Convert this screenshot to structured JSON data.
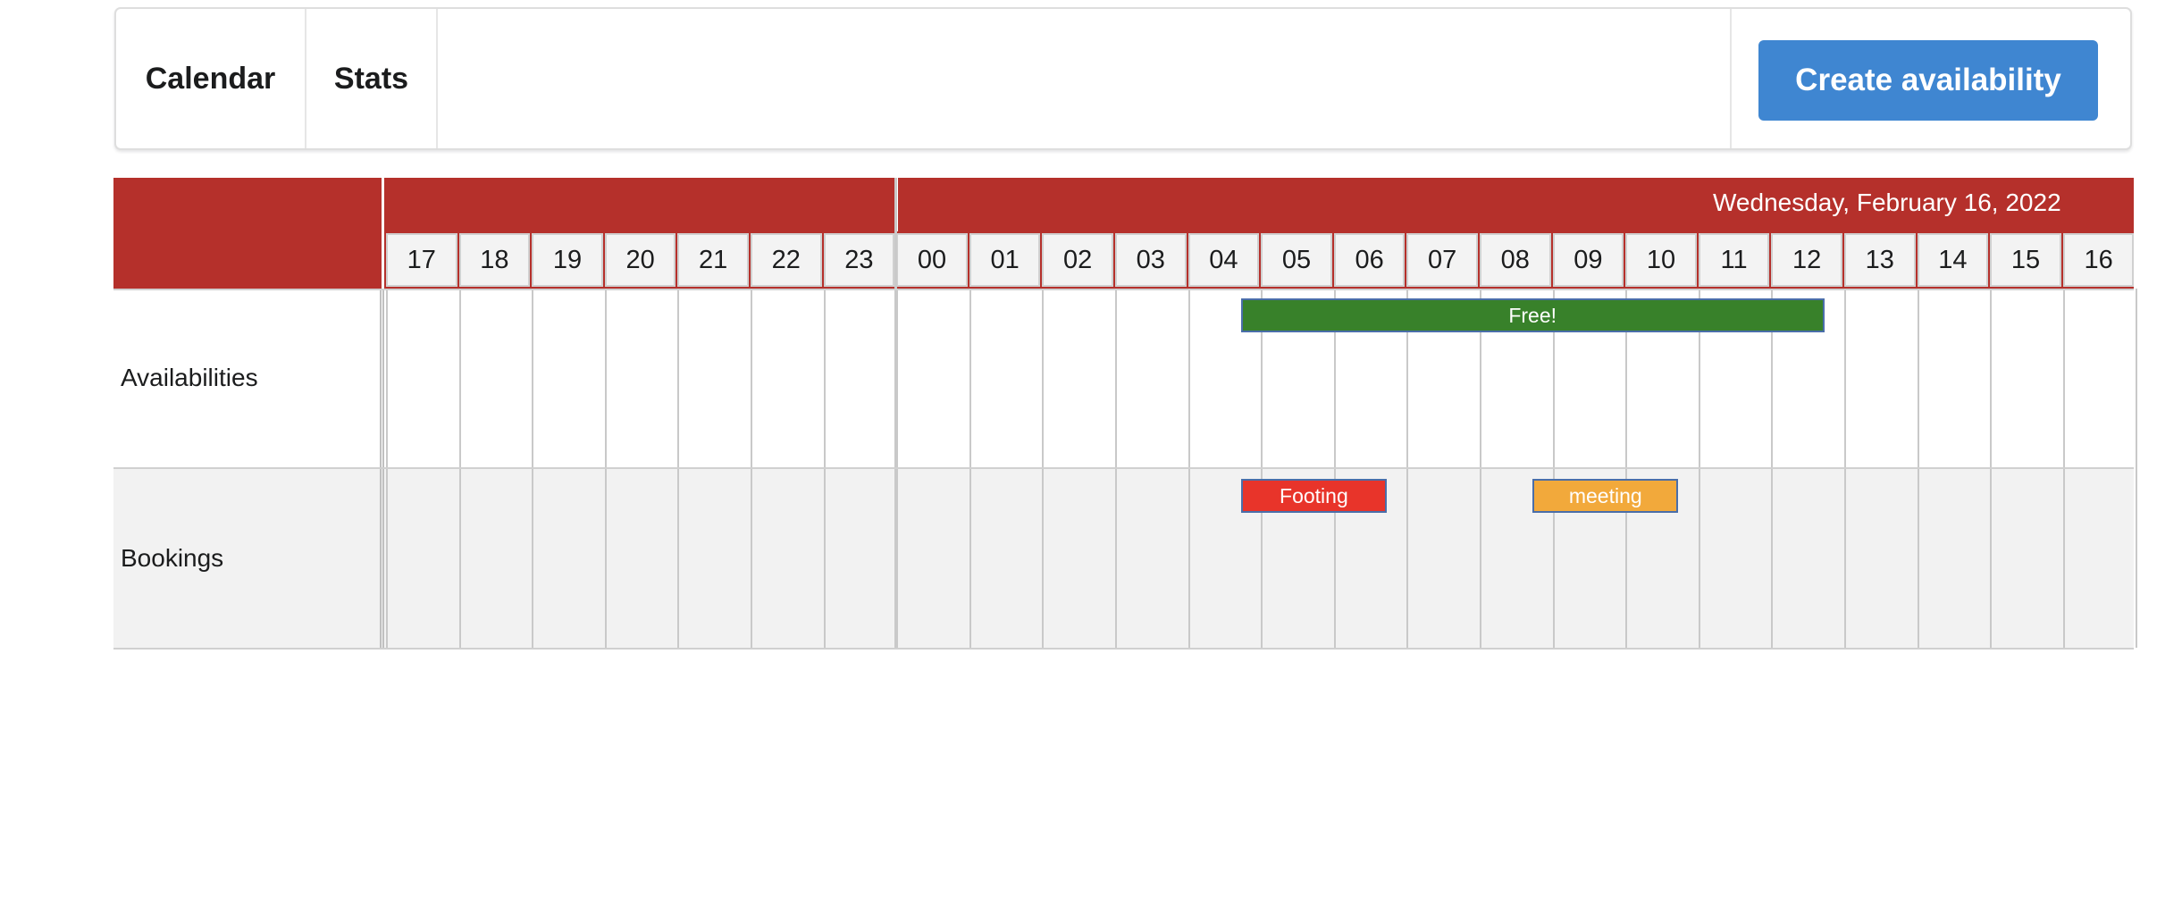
{
  "menu": {
    "calendar_label": "Calendar",
    "stats_label": "Stats",
    "create_button_label": "Create availability"
  },
  "timeline": {
    "day_label": "Wednesday, February 16, 2022",
    "hours": [
      "17",
      "18",
      "19",
      "20",
      "21",
      "22",
      "23",
      "00",
      "01",
      "02",
      "03",
      "04",
      "05",
      "06",
      "07",
      "08",
      "09",
      "10",
      "11",
      "12",
      "13",
      "14",
      "15",
      "16"
    ],
    "rows": [
      {
        "label": "Availabilities"
      },
      {
        "label": "Bookings"
      }
    ],
    "events": [
      {
        "row": 0,
        "title": "Free!",
        "start_hour": 4.75,
        "end_hour": 12.75,
        "color": "#38812a"
      },
      {
        "row": 1,
        "title": "Footing",
        "start_hour": 4.75,
        "end_hour": 6.75,
        "color": "#e8342a"
      },
      {
        "row": 1,
        "title": "meeting",
        "start_hour": 8.75,
        "end_hour": 10.75,
        "color": "#f2a93b"
      }
    ]
  },
  "colors": {
    "header_red": "#b5302b",
    "primary_blue": "#3f86d1",
    "bookings_bg": "#f2f2f2"
  }
}
